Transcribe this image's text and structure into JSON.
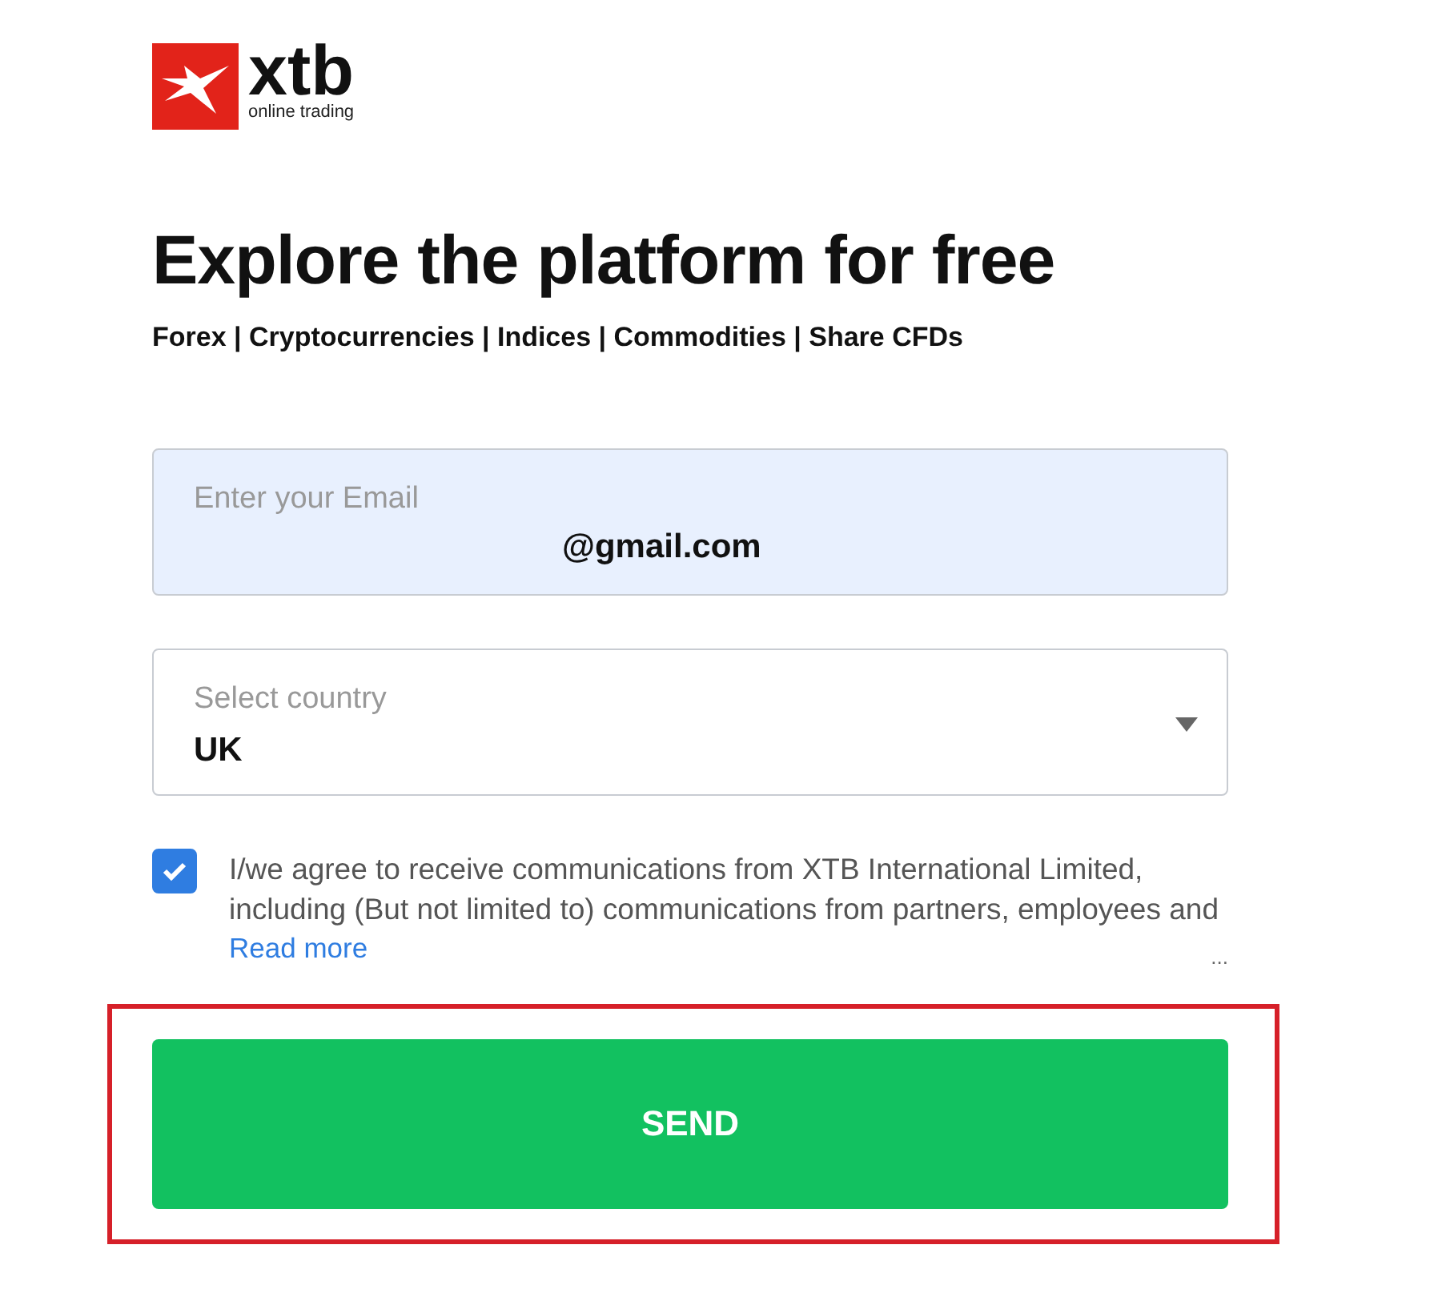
{
  "logo": {
    "wordmark": "xtb",
    "tagline": "online trading"
  },
  "heading": "Explore the platform for free",
  "subtitle": "Forex | Cryptocurrencies | Indices | Commodities | Share CFDs",
  "email": {
    "placeholder": "Enter your Email",
    "value": "@gmail.com"
  },
  "country": {
    "placeholder": "Select country",
    "value": "UK"
  },
  "consent": {
    "checked": true,
    "text": "I/we agree to receive communications from XTB International Limited, including (But not limited to) communications from partners, employees and",
    "link": "Read more",
    "ellipsis": "..."
  },
  "submit": {
    "label": "SEND",
    "highlighted": true
  }
}
